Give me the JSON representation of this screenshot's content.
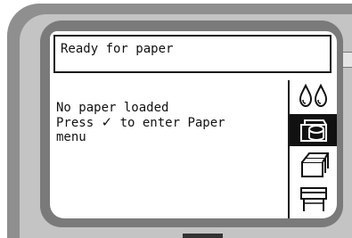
{
  "status": {
    "text": "Ready for paper"
  },
  "message": {
    "line1": "No paper loaded",
    "line2_before": "Press ",
    "line2_check": "✓",
    "line2_after": " to enter Paper",
    "line3": "menu"
  },
  "icons": [
    {
      "name": "ink-drops-icon",
      "selected": false
    },
    {
      "name": "paper-roll-icon",
      "selected": true
    },
    {
      "name": "paper-stack-icon",
      "selected": false
    },
    {
      "name": "printer-icon",
      "selected": false
    }
  ],
  "colors": {
    "screen_bg": "#ffffff",
    "text": "#111111",
    "bezel": "#c4c4c4",
    "frame": "#7a7a7a"
  }
}
